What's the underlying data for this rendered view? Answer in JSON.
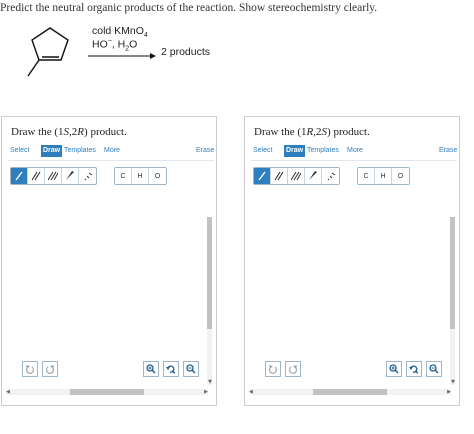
{
  "question": "Predict the neutral organic products of the reaction. Show stereochemistry clearly.",
  "reaction": {
    "reagent_line1": "cold KMnO",
    "reagent_line1_sub": "4",
    "reagent_line2": "HO",
    "reagent_line2_sup": "−",
    "reagent_line2_rest": ", H",
    "reagent_line2_sub": "2",
    "reagent_line2_end": "O",
    "product_text": "2 products"
  },
  "panels": [
    {
      "title_prefix": "Draw the (1",
      "title_s1": "S",
      "title_mid": ",2",
      "title_s2": "R",
      "title_suffix": ") product.",
      "toolbar": {
        "select": "Select",
        "draw": "Draw",
        "templates": "Templates",
        "more": "More",
        "erase": "Erase"
      },
      "atoms": [
        "C",
        "H",
        "O"
      ]
    },
    {
      "title_prefix": "Draw the (1",
      "title_s1": "R",
      "title_mid": ",2",
      "title_s2": "S",
      "title_suffix": ") product.",
      "toolbar": {
        "select": "Select",
        "draw": "Draw",
        "templates": "Templates",
        "more": "More",
        "erase": "Erase"
      },
      "atoms": [
        "C",
        "H",
        "O"
      ]
    }
  ],
  "colors": {
    "accent": "#2f7fbf",
    "border": "#c9ced4"
  }
}
